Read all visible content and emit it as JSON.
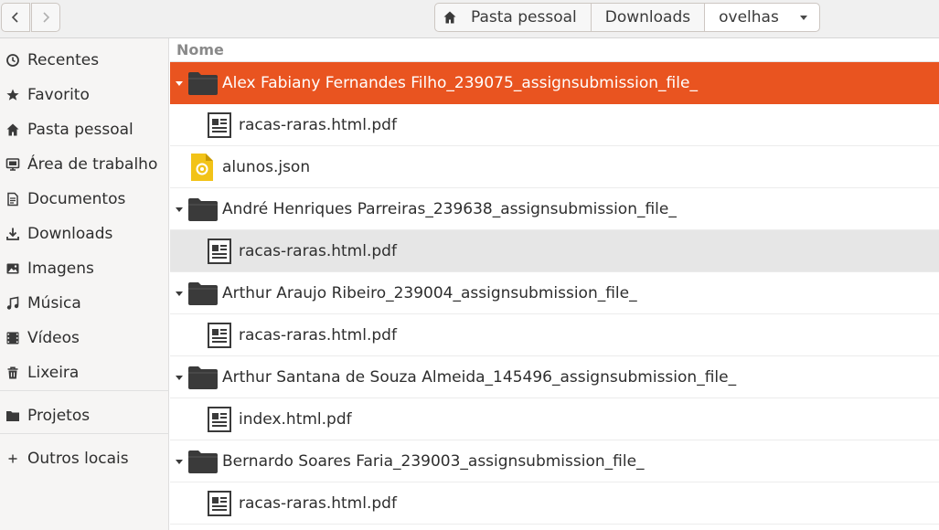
{
  "header": {
    "back_icon": "chevron-left-icon",
    "forward_icon": "chevron-right-icon",
    "breadcrumbs": [
      {
        "label": "Pasta pessoal",
        "icon": "home-icon"
      },
      {
        "label": "Downloads"
      },
      {
        "label": "ovelhas",
        "icon": "dropdown-arrow-icon"
      }
    ]
  },
  "sidebar": {
    "items": [
      {
        "label": "Recentes",
        "icon": "clock-icon"
      },
      {
        "label": "Favorito",
        "icon": "star-icon"
      },
      {
        "label": "Pasta pessoal",
        "icon": "home-icon"
      },
      {
        "label": "Área de trabalho",
        "icon": "desktop-icon"
      },
      {
        "label": "Documentos",
        "icon": "document-icon"
      },
      {
        "label": "Downloads",
        "icon": "download-icon"
      },
      {
        "label": "Imagens",
        "icon": "image-icon"
      },
      {
        "label": "Música",
        "icon": "music-icon"
      },
      {
        "label": "Vídeos",
        "icon": "video-icon"
      },
      {
        "label": "Lixeira",
        "icon": "trash-icon"
      },
      {
        "label": "Projetos",
        "icon": "folder-icon"
      },
      {
        "label": "Outros locais",
        "icon": "plus-icon"
      }
    ]
  },
  "list": {
    "column_header": "Nome",
    "rows": [
      {
        "name": "Alex Fabiany Fernandes Filho_239075_assignsubmission_file_",
        "type": "folder",
        "expanded": true,
        "selected": true
      },
      {
        "name": "racas-raras.html.pdf",
        "type": "pdf"
      },
      {
        "name": "alunos.json",
        "type": "json"
      },
      {
        "name": "André Henriques Parreiras_239638_assignsubmission_file_",
        "type": "folder",
        "expanded": true
      },
      {
        "name": "racas-raras.html.pdf",
        "type": "pdf",
        "hovered": true
      },
      {
        "name": "Arthur Araujo Ribeiro_239004_assignsubmission_file_",
        "type": "folder",
        "expanded": true
      },
      {
        "name": "racas-raras.html.pdf",
        "type": "pdf"
      },
      {
        "name": "Arthur Santana de Souza Almeida_145496_assignsubmission_file_",
        "type": "folder",
        "expanded": true
      },
      {
        "name": "index.html.pdf",
        "type": "pdf"
      },
      {
        "name": "Bernardo Soares Faria_239003_assignsubmission_file_",
        "type": "folder",
        "expanded": true
      },
      {
        "name": "racas-raras.html.pdf",
        "type": "pdf"
      }
    ]
  },
  "colors": {
    "accent": "#e95420",
    "folder": "#3a3a3a",
    "json_icon": "#f2c318"
  }
}
